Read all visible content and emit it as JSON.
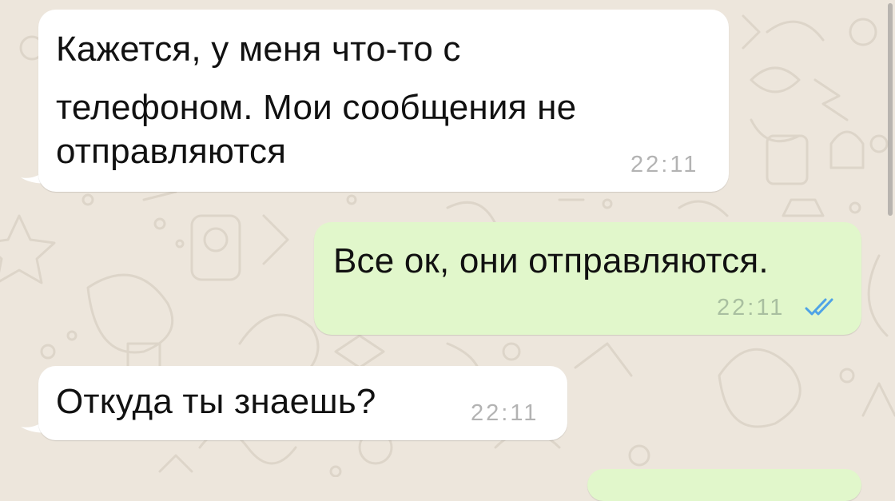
{
  "conversation": {
    "messages": [
      {
        "direction": "incoming",
        "lines": [
          "Кажется, у меня  что-то с",
          "телефоном. Мои сообщения не",
          "отправляются"
        ],
        "time": "22:11"
      },
      {
        "direction": "outgoing",
        "lines": [
          "Все ок, они отправляются."
        ],
        "time": "22:11",
        "status_icon": "double-check-read-icon"
      },
      {
        "direction": "incoming",
        "lines": [
          "Откуда ты знаешь?"
        ],
        "time": "22:11"
      }
    ]
  },
  "colors": {
    "background": "#ede6dc",
    "incoming_bubble": "#ffffff",
    "outgoing_bubble": "#e1f7cb",
    "read_check": "#4fa3e6",
    "timestamp": "#b3b3b3"
  }
}
